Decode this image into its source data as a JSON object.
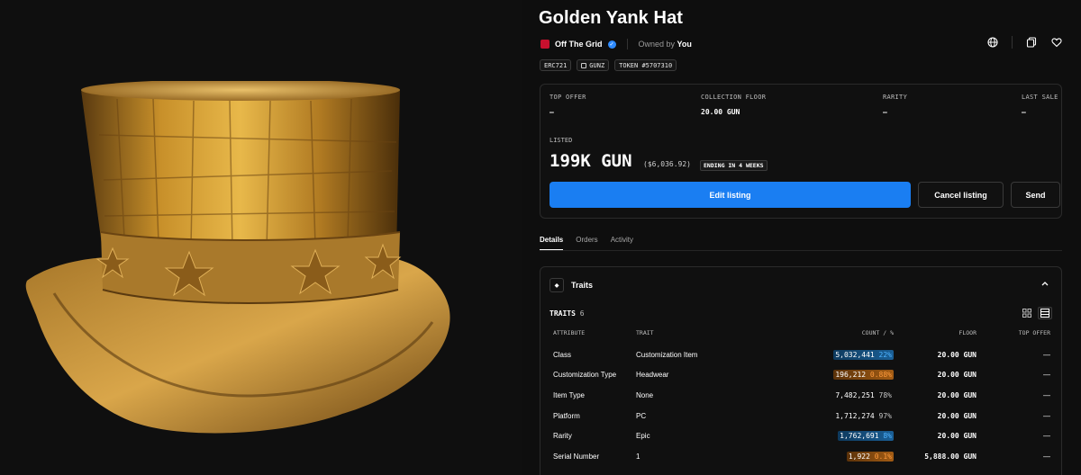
{
  "item": {
    "title": "Golden Yank Hat",
    "collection": "Off The Grid",
    "owned_prefix": "Owned by",
    "owner": "You"
  },
  "chips": [
    "ERC721",
    "GUNZ",
    "TOKEN #5707310"
  ],
  "stats": {
    "top_offer": {
      "label": "TOP OFFER",
      "value": "–"
    },
    "collection_floor": {
      "label": "COLLECTION FLOOR",
      "value": "20.00 GUN"
    },
    "rarity": {
      "label": "RARITY",
      "value": "–"
    },
    "last_sale": {
      "label": "LAST SALE",
      "value": "–"
    }
  },
  "listing": {
    "label": "LISTED",
    "price": "199K GUN",
    "usd": "($6,036.92)",
    "ending": "ENDING IN 4 WEEKS",
    "edit_label": "Edit listing",
    "cancel_label": "Cancel listing",
    "send_label": "Send"
  },
  "tabs": [
    "Details",
    "Orders",
    "Activity"
  ],
  "traits_panel": {
    "title": "Traits",
    "count_label": "TRAITS",
    "count": "6",
    "columns": [
      "ATTRIBUTE",
      "TRAIT",
      "COUNT / %",
      "FLOOR",
      "TOP OFFER"
    ],
    "rows": [
      {
        "attribute": "Class",
        "trait": "Customization Item",
        "count": "5,032,441",
        "pct": "22%",
        "floor": "20.00 GUN",
        "top_offer": "—"
      },
      {
        "attribute": "Customization Type",
        "trait": "Headwear",
        "count": "196,212",
        "pct": "0.88%",
        "floor": "20.00 GUN",
        "top_offer": "—"
      },
      {
        "attribute": "Item Type",
        "trait": "None",
        "count": "7,482,251",
        "pct": "78%",
        "floor": "20.00 GUN",
        "top_offer": "—"
      },
      {
        "attribute": "Platform",
        "trait": "PC",
        "count": "1,712,274",
        "pct": "97%",
        "floor": "20.00 GUN",
        "top_offer": "—"
      },
      {
        "attribute": "Rarity",
        "trait": "Epic",
        "count": "1,762,691",
        "pct": "8%",
        "floor": "20.00 GUN",
        "top_offer": "—"
      },
      {
        "attribute": "Serial Number",
        "trait": "1",
        "count": "1,922",
        "pct": "0.1%",
        "floor": "5,888.00 GUN",
        "top_offer": "—"
      }
    ]
  },
  "colors": {
    "accent": "#1a7ef2",
    "brand": "#c8102e",
    "pct_blue": "#4fb3ff",
    "pct_orange": "#ff9b3d"
  },
  "icons": [
    "globe-icon",
    "copy-icon",
    "heart-icon",
    "chevron-up-icon",
    "grid-view-icon",
    "list-view-icon",
    "diamond-icon",
    "verified-icon"
  ]
}
